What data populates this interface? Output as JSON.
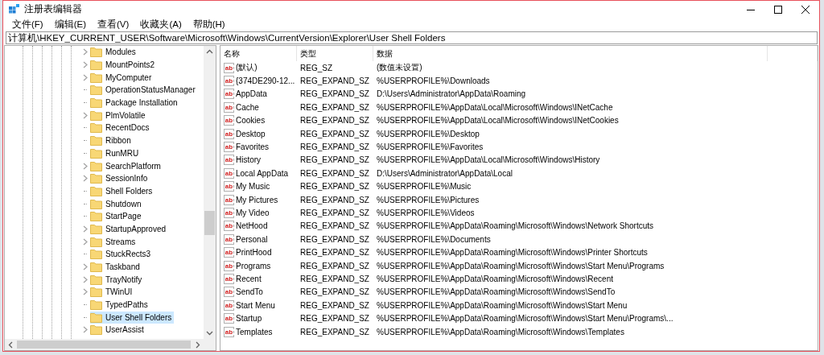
{
  "window": {
    "title": "注册表编辑器"
  },
  "menu": [
    "文件(F)",
    "编辑(E)",
    "查看(V)",
    "收藏夹(A)",
    "帮助(H)"
  ],
  "address": "计算机\\HKEY_CURRENT_USER\\Software\\Microsoft\\Windows\\CurrentVersion\\Explorer\\User Shell Folders",
  "tree": [
    {
      "label": "Modules",
      "expandable": true,
      "selected": false
    },
    {
      "label": "MountPoints2",
      "expandable": true,
      "selected": false
    },
    {
      "label": "MyComputer",
      "expandable": true,
      "selected": false
    },
    {
      "label": "OperationStatusManager",
      "expandable": false,
      "selected": false
    },
    {
      "label": "Package Installation",
      "expandable": false,
      "selected": false
    },
    {
      "label": "PlmVolatile",
      "expandable": true,
      "selected": false
    },
    {
      "label": "RecentDocs",
      "expandable": false,
      "selected": false
    },
    {
      "label": "Ribbon",
      "expandable": false,
      "selected": false
    },
    {
      "label": "RunMRU",
      "expandable": false,
      "selected": false
    },
    {
      "label": "SearchPlatform",
      "expandable": true,
      "selected": false
    },
    {
      "label": "SessionInfo",
      "expandable": true,
      "selected": false
    },
    {
      "label": "Shell Folders",
      "expandable": false,
      "selected": false
    },
    {
      "label": "Shutdown",
      "expandable": false,
      "selected": false
    },
    {
      "label": "StartPage",
      "expandable": false,
      "selected": false
    },
    {
      "label": "StartupApproved",
      "expandable": true,
      "selected": false
    },
    {
      "label": "Streams",
      "expandable": true,
      "selected": false
    },
    {
      "label": "StuckRects3",
      "expandable": false,
      "selected": false
    },
    {
      "label": "Taskband",
      "expandable": true,
      "selected": false
    },
    {
      "label": "TrayNotify",
      "expandable": true,
      "selected": false
    },
    {
      "label": "TWinUI",
      "expandable": true,
      "selected": false
    },
    {
      "label": "TypedPaths",
      "expandable": false,
      "selected": false
    },
    {
      "label": "User Shell Folders",
      "expandable": false,
      "selected": true
    },
    {
      "label": "UserAssist",
      "expandable": true,
      "selected": false
    }
  ],
  "table": {
    "columns": [
      "名称",
      "类型",
      "数据"
    ],
    "rows": [
      {
        "icon": "ab",
        "name": "(默认)",
        "type": "REG_SZ",
        "data": "(数值未设置)"
      },
      {
        "icon": "ab",
        "name": "{374DE290-12...",
        "type": "REG_EXPAND_SZ",
        "data": "%USERPROFILE%\\Downloads"
      },
      {
        "icon": "ab",
        "name": "AppData",
        "type": "REG_EXPAND_SZ",
        "data": "D:\\Users\\Administrator\\AppData\\Roaming"
      },
      {
        "icon": "ab",
        "name": "Cache",
        "type": "REG_EXPAND_SZ",
        "data": "%USERPROFILE%\\AppData\\Local\\Microsoft\\Windows\\INetCache"
      },
      {
        "icon": "ab",
        "name": "Cookies",
        "type": "REG_EXPAND_SZ",
        "data": "%USERPROFILE%\\AppData\\Local\\Microsoft\\Windows\\INetCookies"
      },
      {
        "icon": "ab",
        "name": "Desktop",
        "type": "REG_EXPAND_SZ",
        "data": "%USERPROFILE%\\Desktop"
      },
      {
        "icon": "ab",
        "name": "Favorites",
        "type": "REG_EXPAND_SZ",
        "data": "%USERPROFILE%\\Favorites"
      },
      {
        "icon": "ab",
        "name": "History",
        "type": "REG_EXPAND_SZ",
        "data": "%USERPROFILE%\\AppData\\Local\\Microsoft\\Windows\\History"
      },
      {
        "icon": "ab",
        "name": "Local AppData",
        "type": "REG_EXPAND_SZ",
        "data": "D:\\Users\\Administrator\\AppData\\Local"
      },
      {
        "icon": "ab",
        "name": "My Music",
        "type": "REG_EXPAND_SZ",
        "data": "%USERPROFILE%\\Music"
      },
      {
        "icon": "ab",
        "name": "My Pictures",
        "type": "REG_EXPAND_SZ",
        "data": "%USERPROFILE%\\Pictures"
      },
      {
        "icon": "ab",
        "name": "My Video",
        "type": "REG_EXPAND_SZ",
        "data": "%USERPROFILE%\\Videos"
      },
      {
        "icon": "ab",
        "name": "NetHood",
        "type": "REG_EXPAND_SZ",
        "data": "%USERPROFILE%\\AppData\\Roaming\\Microsoft\\Windows\\Network Shortcuts"
      },
      {
        "icon": "ab",
        "name": "Personal",
        "type": "REG_EXPAND_SZ",
        "data": "%USERPROFILE%\\Documents"
      },
      {
        "icon": "ab",
        "name": "PrintHood",
        "type": "REG_EXPAND_SZ",
        "data": "%USERPROFILE%\\AppData\\Roaming\\Microsoft\\Windows\\Printer Shortcuts"
      },
      {
        "icon": "ab",
        "name": "Programs",
        "type": "REG_EXPAND_SZ",
        "data": "%USERPROFILE%\\AppData\\Roaming\\Microsoft\\Windows\\Start Menu\\Programs"
      },
      {
        "icon": "ab",
        "name": "Recent",
        "type": "REG_EXPAND_SZ",
        "data": "%USERPROFILE%\\AppData\\Roaming\\Microsoft\\Windows\\Recent"
      },
      {
        "icon": "ab",
        "name": "SendTo",
        "type": "REG_EXPAND_SZ",
        "data": "%USERPROFILE%\\AppData\\Roaming\\Microsoft\\Windows\\SendTo"
      },
      {
        "icon": "ab",
        "name": "Start Menu",
        "type": "REG_EXPAND_SZ",
        "data": "%USERPROFILE%\\AppData\\Roaming\\Microsoft\\Windows\\Start Menu"
      },
      {
        "icon": "ab",
        "name": "Startup",
        "type": "REG_EXPAND_SZ",
        "data": "%USERPROFILE%\\AppData\\Roaming\\Microsoft\\Windows\\Start Menu\\Programs\\..."
      },
      {
        "icon": "ab",
        "name": "Templates",
        "type": "REG_EXPAND_SZ",
        "data": "%USERPROFILE%\\AppData\\Roaming\\Microsoft\\Windows\\Templates"
      }
    ]
  }
}
